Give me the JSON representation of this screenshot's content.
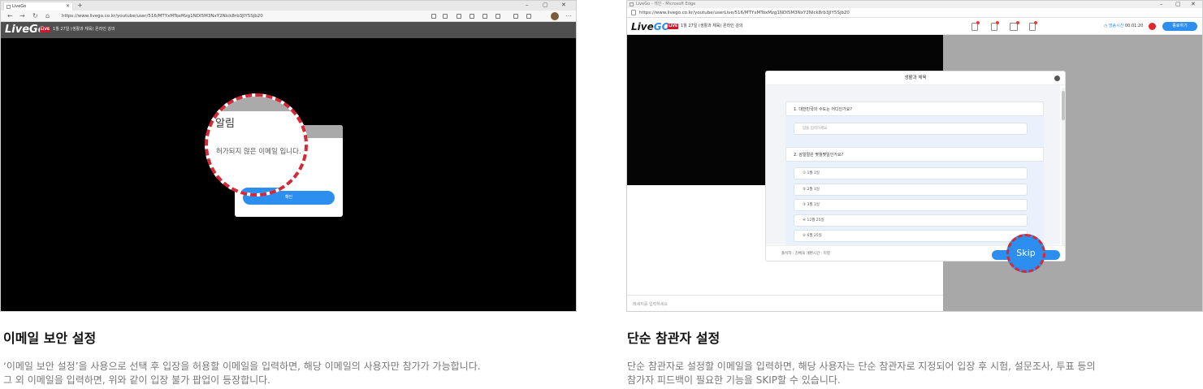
{
  "left": {
    "tab_title": "LiveGo",
    "url": "https://www.livego.co.kr/youtube/user/516/MTYxMToxMzg1NDI5M3NxY2Nlck8rb3JlY5Sjb20",
    "logo": "LiveGo",
    "live_badge": "LIVE",
    "course_title": "1월 27일 (생활과 체육) 온라인 강의",
    "popup": {
      "title": "알림",
      "message": "허가되지 않은 이메일 입니다.",
      "confirm_label": "확인"
    },
    "caption": {
      "title": "이메일 보안 설정",
      "desc_line1": "‘이메일 보안 설정’을 사용으로 선택 후 입장을 허용할 이메일을 입력하면, 해당 이메일의 사용자만 참가가 가능합니다.",
      "desc_line2": "그 외 이메일을 입력하면, 위와 같이 입장 불가 팝업이 등장합니다."
    }
  },
  "right": {
    "window_title": "LiveGo - 개인 - Microsoft Edge",
    "url": "https://www.livego.co.kr/youtube/userLive/516/MTYxMToxMzg1NDI5M3NxY2Nlck8rb3JlY5Sjb20",
    "logo_left": "Live",
    "logo_right": "GO",
    "live_badge": "LIVE",
    "course_title": "1월 27일 (생활과 체육) 온라인 강의",
    "timer_label": "방송시간",
    "timer_value": "00:01:20",
    "end_button": "종료하기",
    "quiz": {
      "title": "생활과 체육",
      "q1": "1. 대한민국의 수도는 어디인가요?",
      "q1_placeholder": "답을 입력하세요",
      "q2": "2. 삼일절은 몇월몇일인가요?",
      "options": [
        "① 1월 1일",
        "② 2월 1일",
        "③ 3월 1일",
        "④ 12월 25일",
        "⑤ 6월 25일"
      ],
      "footer_meta": "출석자 : 김체육   개편시간 : 미정"
    },
    "skip_label": "Skip",
    "chat_placeholder": "메세지를 입력하세요",
    "caption": {
      "title": "단순 참관자 설정",
      "desc_line1": "단순 참관자로 설정할 이메일을 입력하면, 해당 사용자는 단순 참관자로 지정되어 입장 후 시험, 설문조사, 투표 등의",
      "desc_line2": "참가자 피드백이 필요한 기능을 SKIP할 수 있습니다."
    }
  }
}
